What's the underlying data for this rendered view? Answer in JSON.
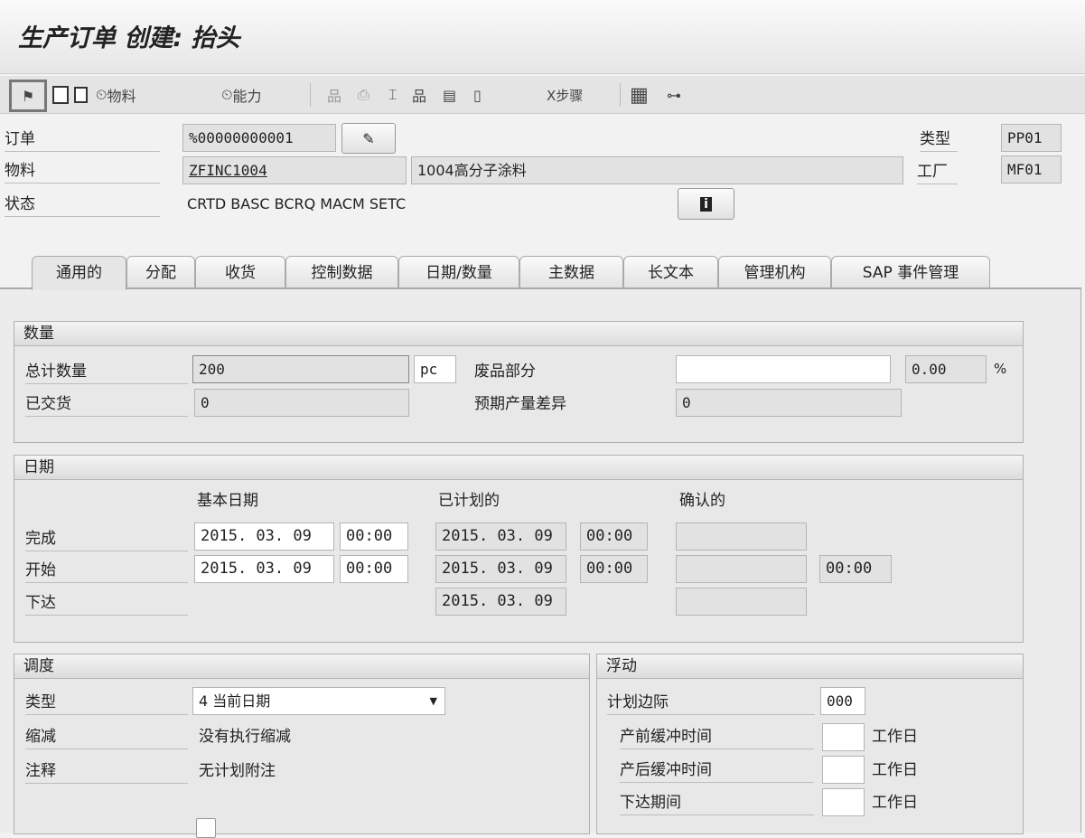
{
  "title": "生产订单 创建: 抬头",
  "toolbar": {
    "material_label": "物料",
    "capacity_label": "能力",
    "steps_label": "X步骤"
  },
  "header": {
    "order_label": "订单",
    "order_value": "%00000000001",
    "material_label": "物料",
    "material_value": "ZFINC1004",
    "material_desc": "1004高分子涂料",
    "status_label": "状态",
    "status_value": "CRTD BASC BCRQ MACM SETC",
    "type_label": "类型",
    "type_value": "PP01",
    "plant_label": "工厂",
    "plant_value": "MF01"
  },
  "tabs": [
    "通用的",
    "分配",
    "收货",
    "控制数据",
    "日期/数量",
    "主数据",
    "长文本",
    "管理机构",
    "SAP 事件管理"
  ],
  "quantity": {
    "title": "数量",
    "total_label": "总计数量",
    "total_value": "200",
    "unit": "pc",
    "scrap_label": "废品部分",
    "scrap_value": "",
    "scrap_pct": "0.00",
    "pct_sign": "%",
    "delivered_label": "已交货",
    "delivered_value": "0",
    "variance_label": "预期产量差异",
    "variance_value": "0"
  },
  "dates": {
    "title": "日期",
    "col_basic": "基本日期",
    "col_planned": "已计划的",
    "col_confirmed": "确认的",
    "finish_label": "完成",
    "finish_basic_date": "2015. 03. 09",
    "finish_basic_time": "00:00",
    "finish_planned_date": "2015. 03. 09",
    "finish_planned_time": "00:00",
    "start_label": "开始",
    "start_basic_date": "2015. 03. 09",
    "start_basic_time": "00:00",
    "start_planned_date": "2015. 03. 09",
    "start_planned_time": "00:00",
    "start_confirmed_time": "00:00",
    "release_label": "下达",
    "release_planned_date": "2015. 03. 09"
  },
  "scheduling": {
    "title": "调度",
    "type_label": "类型",
    "type_value": "4 当前日期",
    "reduction_label": "缩减",
    "reduction_value": "没有执行缩减",
    "note_label": "注释",
    "note_value": "无计划附注"
  },
  "float": {
    "title": "浮动",
    "margin_label": "计划边际",
    "margin_value": "000",
    "pre_label": "产前缓冲时间",
    "post_label": "产后缓冲时间",
    "release_label": "下达期间",
    "unit": "工作日"
  }
}
